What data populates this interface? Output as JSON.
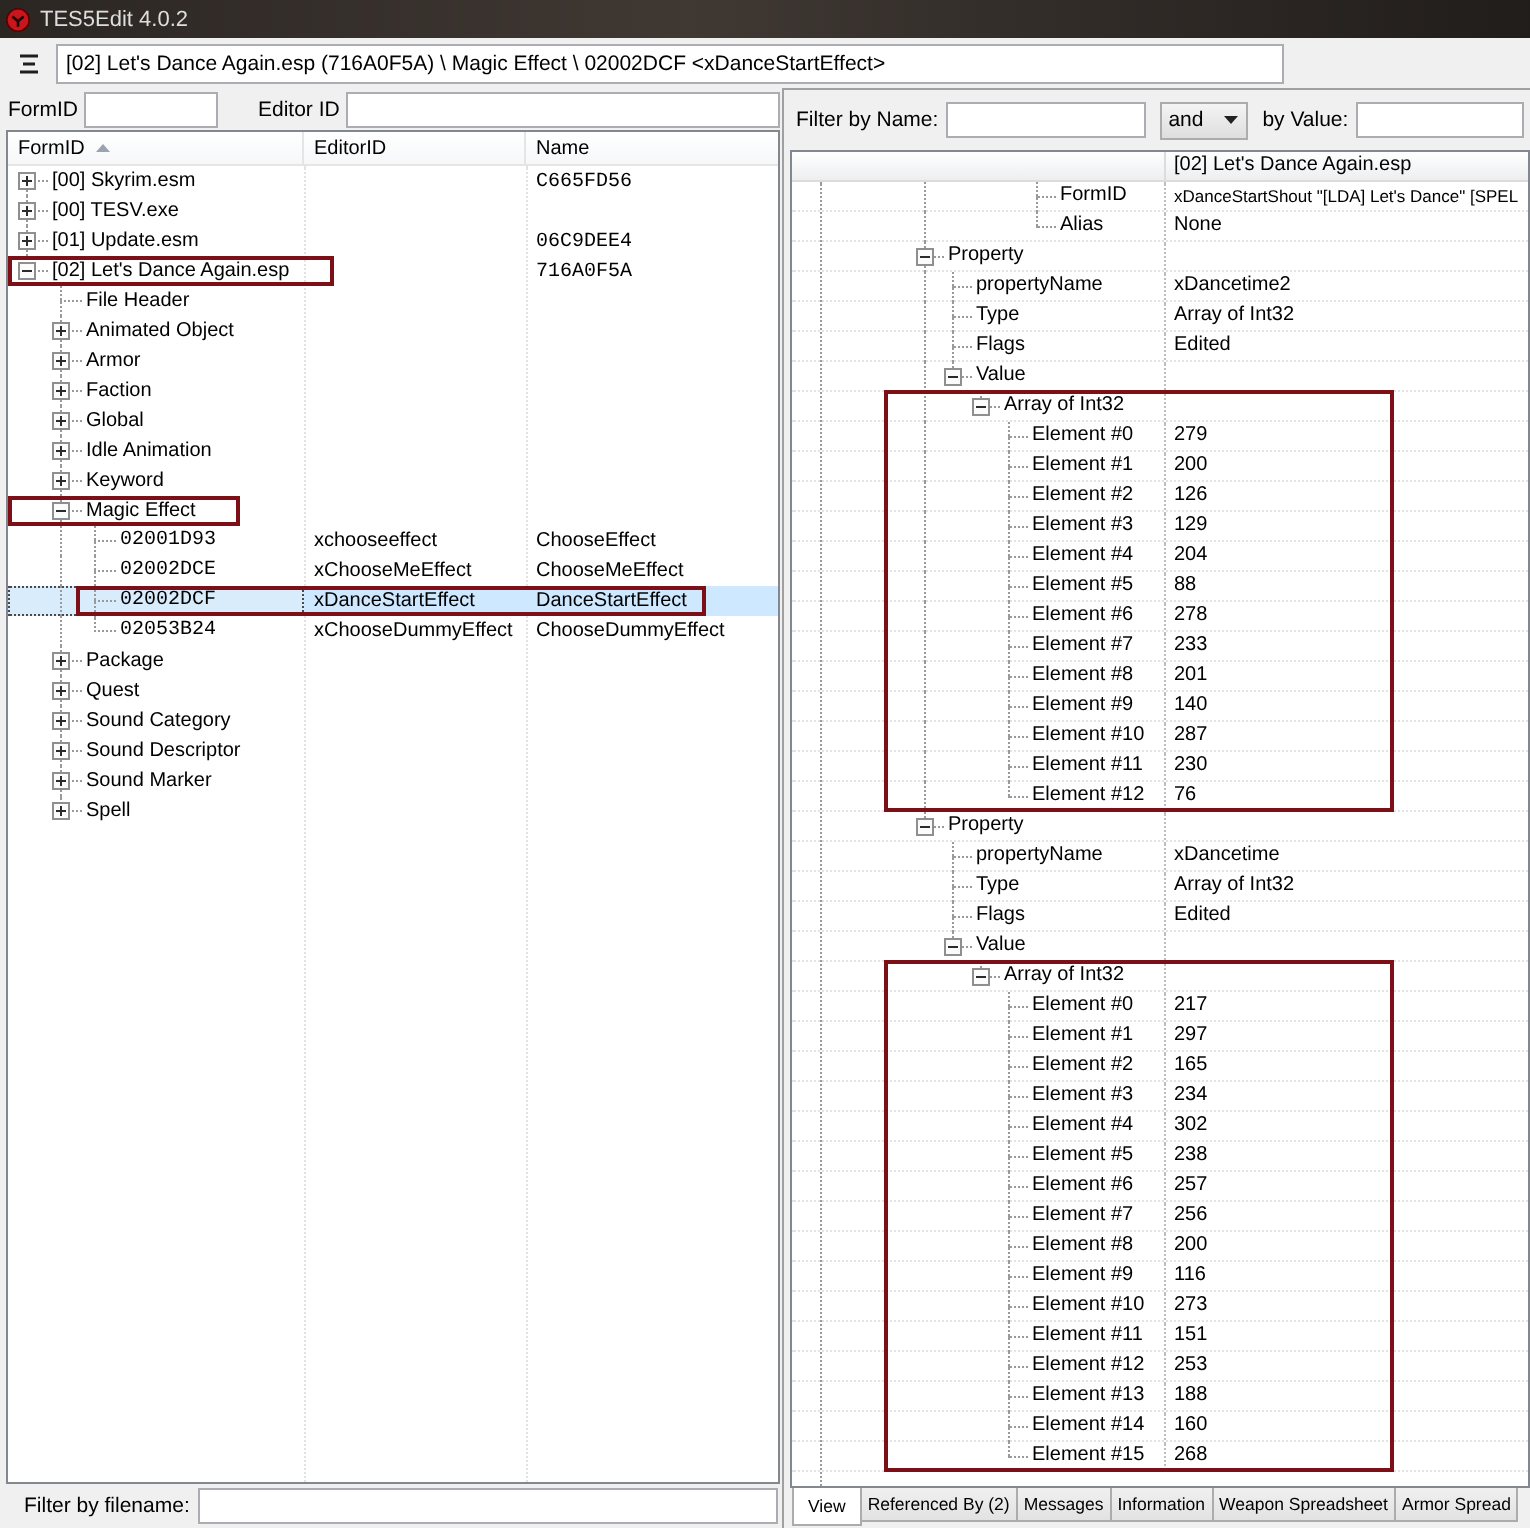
{
  "window": {
    "title": "TES5Edit 4.0.2"
  },
  "toolbar": {
    "path": "[02] Let's Dance Again.esp (716A0F5A) \\ Magic Effect \\ 02002DCF <xDanceStartEffect>"
  },
  "navigator": {
    "filters": [
      {
        "label": "FormID"
      },
      {
        "label": "Editor ID"
      }
    ],
    "columns": [
      {
        "label": "FormID",
        "sorted": true
      },
      {
        "label": "EditorID",
        "sorted": false
      },
      {
        "label": "Name",
        "sorted": false
      }
    ],
    "nodes": [
      {
        "kind": "file",
        "label": "[00] Skyrim.esm",
        "name": "C665FD56",
        "expanded": false,
        "selected": false,
        "framed": false
      },
      {
        "kind": "file",
        "label": "[00] TESV.exe",
        "expanded": false,
        "selected": false,
        "framed": false
      },
      {
        "kind": "file",
        "label": "[01] Update.esm",
        "name": "06C9DEE4",
        "expanded": false,
        "selected": false,
        "framed": false
      },
      {
        "kind": "file",
        "label": "[02] Let's Dance Again.esp",
        "name": "716A0F5A",
        "expanded": true,
        "selected": false,
        "framed": true,
        "children": [
          {
            "kind": "header",
            "label": "File Header",
            "selected": false,
            "framed": false
          },
          {
            "kind": "group",
            "label": "Animated Object",
            "expanded": false,
            "selected": false,
            "framed": false
          },
          {
            "kind": "group",
            "label": "Armor",
            "expanded": false,
            "selected": false,
            "framed": false
          },
          {
            "kind": "group",
            "label": "Faction",
            "expanded": false,
            "selected": false,
            "framed": false
          },
          {
            "kind": "group",
            "label": "Global",
            "expanded": false,
            "selected": false,
            "framed": false
          },
          {
            "kind": "group",
            "label": "Idle Animation",
            "expanded": false,
            "selected": false,
            "framed": false
          },
          {
            "kind": "group",
            "label": "Keyword",
            "expanded": false,
            "selected": false,
            "framed": false
          },
          {
            "kind": "group",
            "label": "Magic Effect",
            "expanded": true,
            "selected": false,
            "framed": true,
            "children": [
              {
                "kind": "record",
                "label": "02001D93",
                "editor_id": "xchooseeffect",
                "name": "ChooseEffect",
                "selected": false,
                "framed": false
              },
              {
                "kind": "record",
                "label": "02002DCE",
                "editor_id": "xChooseMeEffect",
                "name": "ChooseMeEffect",
                "selected": false,
                "framed": false
              },
              {
                "kind": "record",
                "label": "02002DCF",
                "editor_id": "xDanceStartEffect",
                "name": "DanceStartEffect",
                "selected": true,
                "framed": true
              },
              {
                "kind": "record",
                "label": "02053B24",
                "editor_id": "xChooseDummyEffect",
                "name": "ChooseDummyEffect",
                "selected": false,
                "framed": false
              }
            ]
          },
          {
            "kind": "group",
            "label": "Package",
            "expanded": false,
            "selected": false,
            "framed": false
          },
          {
            "kind": "group",
            "label": "Quest",
            "expanded": false,
            "selected": false,
            "framed": false
          },
          {
            "kind": "group",
            "label": "Sound Category",
            "expanded": false,
            "selected": false,
            "framed": false
          },
          {
            "kind": "group",
            "label": "Sound Descriptor",
            "expanded": false,
            "selected": false,
            "framed": false
          },
          {
            "kind": "group",
            "label": "Sound Marker",
            "expanded": false,
            "selected": false,
            "framed": false
          },
          {
            "kind": "group",
            "label": "Spell",
            "expanded": false,
            "selected": false,
            "framed": false
          }
        ]
      }
    ],
    "file_filter": {
      "label": "Filter by filename:"
    }
  },
  "record_view": {
    "name_filter": {
      "label": "Filter by Name:"
    },
    "operator": {
      "value": "and"
    },
    "value_filter": {
      "label": "by Value:"
    },
    "header": "[02] Let's Dance Again.esp",
    "rows": [
      {
        "kind": "offscreen",
        "children": [
          {
            "kind": "offscreen",
            "children": [
              {
                "kind": "offscreen",
                "children": [
                  {
                    "kind": "offscreen",
                    "children": [
                      {
                        "kind": "field",
                        "label": "FormID",
                        "value": "xDanceStartShout \"[LDA] Let's Dance\" [SPEL",
                        "framed": false
                      },
                      {
                        "kind": "field",
                        "label": "Alias",
                        "value": "None",
                        "framed": false
                      }
                    ]
                  }
                ]
              }
            ]
          }
        ]
      },
      {
        "kind": "node",
        "label": "Property",
        "expanded": true,
        "framed": false,
        "children": [
          {
            "kind": "field",
            "label": "propertyName",
            "value": "xDancetime2",
            "framed": false
          },
          {
            "kind": "field",
            "label": "Type",
            "value": "Array of Int32",
            "framed": false
          },
          {
            "kind": "field",
            "label": "Flags",
            "value": "Edited",
            "framed": false
          },
          {
            "kind": "node",
            "label": "Value",
            "expanded": true,
            "framed": false,
            "children": [
              {
                "kind": "node",
                "label": "Array of Int32",
                "expanded": true,
                "framed": true,
                "children": [
                  {
                    "kind": "field",
                    "label": "Element #0",
                    "value": "279",
                    "framed": false
                  },
                  {
                    "kind": "field",
                    "label": "Element #1",
                    "value": "200",
                    "framed": false
                  },
                  {
                    "kind": "field",
                    "label": "Element #2",
                    "value": "126",
                    "framed": false
                  },
                  {
                    "kind": "field",
                    "label": "Element #3",
                    "value": "129",
                    "framed": false
                  },
                  {
                    "kind": "field",
                    "label": "Element #4",
                    "value": "204",
                    "framed": false
                  },
                  {
                    "kind": "field",
                    "label": "Element #5",
                    "value": "88",
                    "framed": false
                  },
                  {
                    "kind": "field",
                    "label": "Element #6",
                    "value": "278",
                    "framed": false
                  },
                  {
                    "kind": "field",
                    "label": "Element #7",
                    "value": "233",
                    "framed": false
                  },
                  {
                    "kind": "field",
                    "label": "Element #8",
                    "value": "201",
                    "framed": false
                  },
                  {
                    "kind": "field",
                    "label": "Element #9",
                    "value": "140",
                    "framed": false
                  },
                  {
                    "kind": "field",
                    "label": "Element #10",
                    "value": "287",
                    "framed": false
                  },
                  {
                    "kind": "field",
                    "label": "Element #11",
                    "value": "230",
                    "framed": false
                  },
                  {
                    "kind": "field",
                    "label": "Element #12",
                    "value": "76",
                    "framed": false
                  }
                ]
              }
            ]
          }
        ]
      },
      {
        "kind": "node",
        "label": "Property",
        "expanded": true,
        "framed": false,
        "children": [
          {
            "kind": "field",
            "label": "propertyName",
            "value": "xDancetime",
            "framed": false
          },
          {
            "kind": "field",
            "label": "Type",
            "value": "Array of Int32",
            "framed": false
          },
          {
            "kind": "field",
            "label": "Flags",
            "value": "Edited",
            "framed": false
          },
          {
            "kind": "node",
            "label": "Value",
            "expanded": true,
            "framed": false,
            "children": [
              {
                "kind": "node",
                "label": "Array of Int32",
                "expanded": true,
                "framed": true,
                "children": [
                  {
                    "kind": "field",
                    "label": "Element #0",
                    "value": "217",
                    "framed": false
                  },
                  {
                    "kind": "field",
                    "label": "Element #1",
                    "value": "297",
                    "framed": false
                  },
                  {
                    "kind": "field",
                    "label": "Element #2",
                    "value": "165",
                    "framed": false
                  },
                  {
                    "kind": "field",
                    "label": "Element #3",
                    "value": "234",
                    "framed": false
                  },
                  {
                    "kind": "field",
                    "label": "Element #4",
                    "value": "302",
                    "framed": false
                  },
                  {
                    "kind": "field",
                    "label": "Element #5",
                    "value": "238",
                    "framed": false
                  },
                  {
                    "kind": "field",
                    "label": "Element #6",
                    "value": "257",
                    "framed": false
                  },
                  {
                    "kind": "field",
                    "label": "Element #7",
                    "value": "256",
                    "framed": false
                  },
                  {
                    "kind": "field",
                    "label": "Element #8",
                    "value": "200",
                    "framed": false
                  },
                  {
                    "kind": "field",
                    "label": "Element #9",
                    "value": "116",
                    "framed": false
                  },
                  {
                    "kind": "field",
                    "label": "Element #10",
                    "value": "273",
                    "framed": false
                  },
                  {
                    "kind": "field",
                    "label": "Element #11",
                    "value": "151",
                    "framed": false
                  },
                  {
                    "kind": "field",
                    "label": "Element #12",
                    "value": "253",
                    "framed": false
                  },
                  {
                    "kind": "field",
                    "label": "Element #13",
                    "value": "188",
                    "framed": false
                  },
                  {
                    "kind": "field",
                    "label": "Element #14",
                    "value": "160",
                    "framed": false
                  },
                  {
                    "kind": "field",
                    "label": "Element #15",
                    "value": "268",
                    "framed": false
                  }
                ]
              }
            ]
          }
        ]
      }
    ],
    "tabs": [
      {
        "label": "View",
        "selected": true
      },
      {
        "label": "Referenced By (2)",
        "selected": false
      },
      {
        "label": "Messages",
        "selected": false
      },
      {
        "label": "Information",
        "selected": false
      },
      {
        "label": "Weapon Spreadsheet",
        "selected": false
      },
      {
        "label": "Armor Spread",
        "selected": false
      }
    ]
  }
}
